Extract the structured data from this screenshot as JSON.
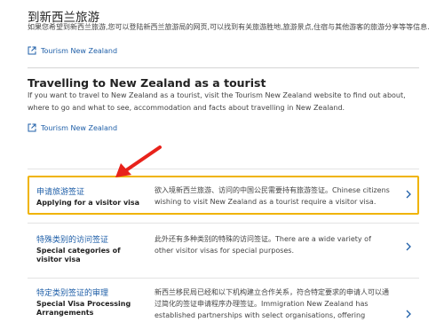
{
  "intro": {
    "zh_heading": "到新西兰旅游",
    "zh_desc": "如果您希望到新西兰旅游,您可以登陆新西兰旅游局的网页,可以找到有关旅游胜地,旅游景点,住宿与其他游客的旅游分享等等信息.",
    "link_label": "Tourism New Zealand"
  },
  "tourist": {
    "heading": "Travelling to New Zealand as a tourist",
    "desc": "If you want to travel to New Zealand as a tourist, visit the Tourism New Zealand website to find out about, where to go and what to see, accommodation and facts about travelling in New Zealand.",
    "link_label": "Tourism New Zealand"
  },
  "rows": [
    {
      "zh_title": "申请旅游签证",
      "en_title": "Applying for a visitor visa",
      "desc": "欲入境新西兰旅游、访问的中国公民需要持有旅游签证。Chinese citizens wishing to visit New Zealand as a tourist require a visitor visa."
    },
    {
      "zh_title": "特殊类别的访问签证",
      "en_title": "Special categories of visitor visa",
      "desc": "此外还有多种类别的特殊的访问签证。There are a wide variety of other visitor visas for special purposes."
    },
    {
      "zh_title": "特定类别签证的审理",
      "en_title": "Special Visa Processing Arrangements",
      "desc": "新西兰移民局已经和以下机构建立合作关系，符合特定要求的申请人可以通过简化的签证申请程序办理签证。Immigration New Zealand has established partnerships with select organisations, offering streamlined visitor visa"
    }
  ],
  "colors": {
    "link": "#1f5fa8",
    "highlight_border": "#f0b400",
    "arrow": "#e8221b"
  }
}
